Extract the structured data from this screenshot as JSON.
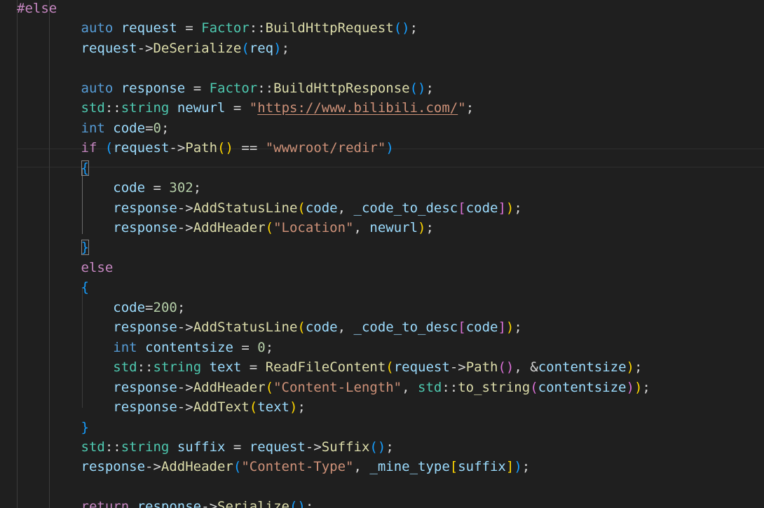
{
  "editor": {
    "language": "C++",
    "theme_colors": {
      "background": "#1f1f1f",
      "keyword": "#569cd6",
      "control": "#c586c0",
      "type": "#4ec9b0",
      "function": "#dcdcaa",
      "variable": "#9cdcfe",
      "number": "#b5cea8",
      "string": "#ce9178",
      "bracket_level_1": "#ffd700",
      "bracket_level_2": "#da70d6",
      "bracket_level_3": "#179fff"
    },
    "lines": [
      {
        "indent": "",
        "tokens": [
          [
            "#else",
            "pp"
          ]
        ]
      },
      {
        "indent": "        ",
        "tokens": [
          [
            "auto",
            "kw"
          ],
          [
            " ",
            "plain"
          ],
          [
            "request",
            "var"
          ],
          [
            " = ",
            "op"
          ],
          [
            "Factor",
            "type"
          ],
          [
            "::",
            "op"
          ],
          [
            "BuildHttpRequest",
            "fn"
          ],
          [
            "(",
            "p3"
          ],
          [
            ")",
            "p3"
          ],
          [
            ";",
            "op"
          ]
        ]
      },
      {
        "indent": "        ",
        "tokens": [
          [
            "request",
            "var"
          ],
          [
            "->",
            "op"
          ],
          [
            "DeSerialize",
            "fn"
          ],
          [
            "(",
            "p3"
          ],
          [
            "req",
            "var"
          ],
          [
            ")",
            "p3"
          ],
          [
            ";",
            "op"
          ]
        ]
      },
      {
        "indent": "",
        "tokens": []
      },
      {
        "indent": "        ",
        "tokens": [
          [
            "auto",
            "kw"
          ],
          [
            " ",
            "plain"
          ],
          [
            "response",
            "var"
          ],
          [
            " = ",
            "op"
          ],
          [
            "Factor",
            "type"
          ],
          [
            "::",
            "op"
          ],
          [
            "BuildHttpResponse",
            "fn"
          ],
          [
            "(",
            "p3"
          ],
          [
            ")",
            "p3"
          ],
          [
            ";",
            "op"
          ]
        ]
      },
      {
        "indent": "        ",
        "tokens": [
          [
            "std",
            "type"
          ],
          [
            "::",
            "op"
          ],
          [
            "string",
            "type"
          ],
          [
            " ",
            "plain"
          ],
          [
            "newurl",
            "var"
          ],
          [
            " = ",
            "op"
          ],
          [
            "\"",
            "str"
          ],
          [
            "https://www.bilibili.com/",
            "url"
          ],
          [
            "\"",
            "str"
          ],
          [
            ";",
            "op"
          ]
        ]
      },
      {
        "indent": "        ",
        "tokens": [
          [
            "int",
            "kw"
          ],
          [
            " ",
            "plain"
          ],
          [
            "code",
            "var"
          ],
          [
            "=",
            "op"
          ],
          [
            "0",
            "num"
          ],
          [
            ";",
            "op"
          ]
        ]
      },
      {
        "indent": "        ",
        "tokens": [
          [
            "if",
            "ctl"
          ],
          [
            " ",
            "plain"
          ],
          [
            "(",
            "p3"
          ],
          [
            "request",
            "var"
          ],
          [
            "->",
            "op"
          ],
          [
            "Path",
            "fn"
          ],
          [
            "(",
            "p1"
          ],
          [
            ")",
            "p1"
          ],
          [
            " == ",
            "op"
          ],
          [
            "\"wwwroot/redir\"",
            "str"
          ],
          [
            ")",
            "p3"
          ]
        ]
      },
      {
        "indent": "        ",
        "tokens": [
          [
            "{",
            "p3",
            "match"
          ]
        ]
      },
      {
        "indent": "            ",
        "tokens": [
          [
            "code",
            "var"
          ],
          [
            " = ",
            "op"
          ],
          [
            "302",
            "num"
          ],
          [
            ";",
            "op"
          ]
        ]
      },
      {
        "indent": "            ",
        "tokens": [
          [
            "response",
            "var"
          ],
          [
            "->",
            "op"
          ],
          [
            "AddStatusLine",
            "fn"
          ],
          [
            "(",
            "p1"
          ],
          [
            "code",
            "var"
          ],
          [
            ", ",
            "op"
          ],
          [
            "_code_to_desc",
            "var"
          ],
          [
            "[",
            "p2"
          ],
          [
            "code",
            "var"
          ],
          [
            "]",
            "p2"
          ],
          [
            ")",
            "p1"
          ],
          [
            ";",
            "op"
          ]
        ]
      },
      {
        "indent": "            ",
        "tokens": [
          [
            "response",
            "var"
          ],
          [
            "->",
            "op"
          ],
          [
            "AddHeader",
            "fn"
          ],
          [
            "(",
            "p1"
          ],
          [
            "\"Location\"",
            "str"
          ],
          [
            ", ",
            "op"
          ],
          [
            "newurl",
            "var"
          ],
          [
            ")",
            "p1"
          ],
          [
            ";",
            "op"
          ]
        ]
      },
      {
        "indent": "        ",
        "tokens": [
          [
            "}",
            "p3",
            "match"
          ]
        ]
      },
      {
        "indent": "        ",
        "tokens": [
          [
            "else",
            "ctl"
          ]
        ]
      },
      {
        "indent": "        ",
        "tokens": [
          [
            "{",
            "p3"
          ]
        ]
      },
      {
        "indent": "            ",
        "tokens": [
          [
            "code",
            "var"
          ],
          [
            "=",
            "op"
          ],
          [
            "200",
            "num"
          ],
          [
            ";",
            "op"
          ]
        ]
      },
      {
        "indent": "            ",
        "tokens": [
          [
            "response",
            "var"
          ],
          [
            "->",
            "op"
          ],
          [
            "AddStatusLine",
            "fn"
          ],
          [
            "(",
            "p1"
          ],
          [
            "code",
            "var"
          ],
          [
            ", ",
            "op"
          ],
          [
            "_code_to_desc",
            "var"
          ],
          [
            "[",
            "p2"
          ],
          [
            "code",
            "var"
          ],
          [
            "]",
            "p2"
          ],
          [
            ")",
            "p1"
          ],
          [
            ";",
            "op"
          ]
        ]
      },
      {
        "indent": "            ",
        "tokens": [
          [
            "int",
            "kw"
          ],
          [
            " ",
            "plain"
          ],
          [
            "contentsize",
            "var"
          ],
          [
            " = ",
            "op"
          ],
          [
            "0",
            "num"
          ],
          [
            ";",
            "op"
          ]
        ]
      },
      {
        "indent": "            ",
        "tokens": [
          [
            "std",
            "type"
          ],
          [
            "::",
            "op"
          ],
          [
            "string",
            "type"
          ],
          [
            " ",
            "plain"
          ],
          [
            "text",
            "var"
          ],
          [
            " = ",
            "op"
          ],
          [
            "ReadFileContent",
            "fn"
          ],
          [
            "(",
            "p1"
          ],
          [
            "request",
            "var"
          ],
          [
            "->",
            "op"
          ],
          [
            "Path",
            "fn"
          ],
          [
            "(",
            "p2"
          ],
          [
            ")",
            "p2"
          ],
          [
            ", &",
            "op"
          ],
          [
            "contentsize",
            "var"
          ],
          [
            ")",
            "p1"
          ],
          [
            ";",
            "op"
          ]
        ]
      },
      {
        "indent": "            ",
        "tokens": [
          [
            "response",
            "var"
          ],
          [
            "->",
            "op"
          ],
          [
            "AddHeader",
            "fn"
          ],
          [
            "(",
            "p1"
          ],
          [
            "\"Content-Length\"",
            "str"
          ],
          [
            ", ",
            "op"
          ],
          [
            "std",
            "type"
          ],
          [
            "::",
            "op"
          ],
          [
            "to_string",
            "fn"
          ],
          [
            "(",
            "p2"
          ],
          [
            "contentsize",
            "var"
          ],
          [
            ")",
            "p2"
          ],
          [
            ")",
            "p1"
          ],
          [
            ";",
            "op"
          ]
        ]
      },
      {
        "indent": "            ",
        "tokens": [
          [
            "response",
            "var"
          ],
          [
            "->",
            "op"
          ],
          [
            "AddText",
            "fn"
          ],
          [
            "(",
            "p1"
          ],
          [
            "text",
            "var"
          ],
          [
            ")",
            "p1"
          ],
          [
            ";",
            "op"
          ]
        ]
      },
      {
        "indent": "        ",
        "tokens": [
          [
            "}",
            "p3"
          ]
        ]
      },
      {
        "indent": "        ",
        "tokens": [
          [
            "std",
            "type"
          ],
          [
            "::",
            "op"
          ],
          [
            "string",
            "type"
          ],
          [
            " ",
            "plain"
          ],
          [
            "suffix",
            "var"
          ],
          [
            " = ",
            "op"
          ],
          [
            "request",
            "var"
          ],
          [
            "->",
            "op"
          ],
          [
            "Suffix",
            "fn"
          ],
          [
            "(",
            "p3"
          ],
          [
            ")",
            "p3"
          ],
          [
            ";",
            "op"
          ]
        ]
      },
      {
        "indent": "        ",
        "tokens": [
          [
            "response",
            "var"
          ],
          [
            "->",
            "op"
          ],
          [
            "AddHeader",
            "fn"
          ],
          [
            "(",
            "p3"
          ],
          [
            "\"Content-Type\"",
            "str"
          ],
          [
            ", ",
            "op"
          ],
          [
            "_mine_type",
            "var"
          ],
          [
            "[",
            "p1"
          ],
          [
            "suffix",
            "var"
          ],
          [
            "]",
            "p1"
          ],
          [
            ")",
            "p3"
          ],
          [
            ";",
            "op"
          ]
        ]
      },
      {
        "indent": "",
        "tokens": []
      },
      {
        "indent": "        ",
        "tokens": [
          [
            "return",
            "ctl"
          ],
          [
            " ",
            "plain"
          ],
          [
            "response",
            "var"
          ],
          [
            "->",
            "op"
          ],
          [
            "Serialize",
            "fn"
          ],
          [
            "(",
            "p3"
          ],
          [
            ")",
            "p3"
          ],
          [
            ";",
            "op"
          ]
        ]
      }
    ]
  }
}
